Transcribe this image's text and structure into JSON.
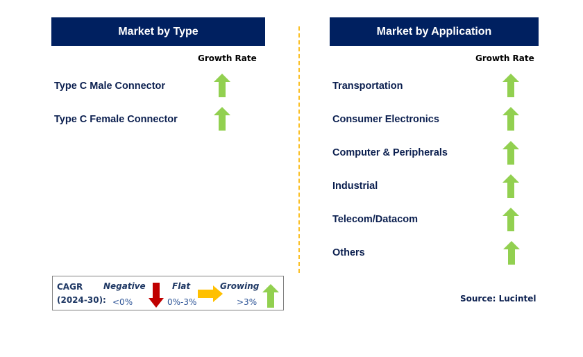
{
  "left_panel": {
    "title": "Market by Type",
    "growth_rate_label": "Growth Rate",
    "items": [
      {
        "label": "Type C Male Connector",
        "trend": "growing"
      },
      {
        "label": "Type C Female Connector",
        "trend": "growing"
      }
    ]
  },
  "right_panel": {
    "title": "Market by Application",
    "growth_rate_label": "Growth Rate",
    "items": [
      {
        "label": "Transportation",
        "trend": "growing"
      },
      {
        "label": "Consumer Electronics",
        "trend": "growing"
      },
      {
        "label": "Computer & Peripherals",
        "trend": "growing"
      },
      {
        "label": "Industrial",
        "trend": "growing"
      },
      {
        "label": "Telecom/Datacom",
        "trend": "growing"
      },
      {
        "label": "Others",
        "trend": "growing"
      }
    ]
  },
  "legend": {
    "cagr_line1": "CAGR",
    "cagr_line2": "(2024-30):",
    "negative_label": "Negative",
    "negative_value": "<0%",
    "flat_label": "Flat",
    "flat_value": "0%-3%",
    "growing_label": "Growing",
    "growing_value": ">3%"
  },
  "source": "Source: Lucintel",
  "colors": {
    "header_bg": "#002060",
    "growing": "#92d050",
    "flat": "#ffc000",
    "negative": "#c00000",
    "divider": "#fbbf24"
  }
}
